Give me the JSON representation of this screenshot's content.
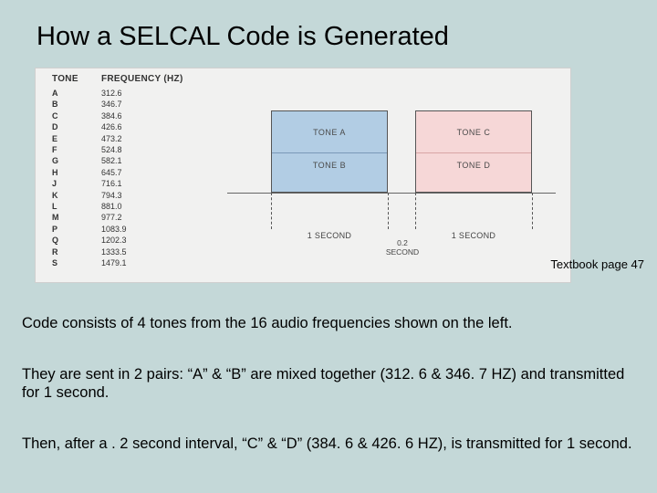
{
  "title": "How a SELCAL Code is Generated",
  "figure": {
    "table": {
      "headers": {
        "tone": "TONE",
        "freq": "FREQUENCY (HZ)"
      },
      "rows": [
        {
          "t": "A",
          "f": "312.6"
        },
        {
          "t": "B",
          "f": "346.7"
        },
        {
          "t": "C",
          "f": "384.6"
        },
        {
          "t": "D",
          "f": "426.6"
        },
        {
          "t": "E",
          "f": "473.2"
        },
        {
          "t": "F",
          "f": "524.8"
        },
        {
          "t": "G",
          "f": "582.1"
        },
        {
          "t": "H",
          "f": "645.7"
        },
        {
          "t": "J",
          "f": "716.1"
        },
        {
          "t": "K",
          "f": "794.3"
        },
        {
          "t": "L",
          "f": "881.0"
        },
        {
          "t": "M",
          "f": "977.2"
        },
        {
          "t": "P",
          "f": "1083.9"
        },
        {
          "t": "Q",
          "f": "1202.3"
        },
        {
          "t": "R",
          "f": "1333.5"
        },
        {
          "t": "S",
          "f": "1479.1"
        }
      ]
    },
    "labels": {
      "toneA": "TONE A",
      "toneB": "TONE B",
      "toneC": "TONE C",
      "toneD": "TONE D",
      "sec1": "1 SECOND",
      "sec2": "1 SECOND",
      "gap_top": "0.2",
      "gap_bot": "SECOND"
    }
  },
  "page_ref": "Textbook page 47",
  "paragraphs": {
    "p1": "Code consists of 4 tones from the 16 audio frequencies shown on the left.",
    "p2": "They are sent in 2 pairs: “A” & “B” are mixed together (312. 6 & 346. 7 HZ) and transmitted for 1 second.",
    "p3": "Then, after a . 2 second interval, “C” & “D” (384. 6 & 426. 6 HZ), is transmitted for 1 second."
  },
  "chart_data": {
    "type": "table",
    "title": "SELCAL tone frequency table and transmission timing",
    "tones": [
      {
        "tone": "A",
        "hz": 312.6
      },
      {
        "tone": "B",
        "hz": 346.7
      },
      {
        "tone": "C",
        "hz": 384.6
      },
      {
        "tone": "D",
        "hz": 426.6
      },
      {
        "tone": "E",
        "hz": 473.2
      },
      {
        "tone": "F",
        "hz": 524.8
      },
      {
        "tone": "G",
        "hz": 582.1
      },
      {
        "tone": "H",
        "hz": 645.7
      },
      {
        "tone": "J",
        "hz": 716.1
      },
      {
        "tone": "K",
        "hz": 794.3
      },
      {
        "tone": "L",
        "hz": 881.0
      },
      {
        "tone": "M",
        "hz": 977.2
      },
      {
        "tone": "P",
        "hz": 1083.9
      },
      {
        "tone": "Q",
        "hz": 1202.3
      },
      {
        "tone": "R",
        "hz": 1333.5
      },
      {
        "tone": "S",
        "hz": 1479.1
      }
    ],
    "timing": {
      "pair1": {
        "tones": [
          "A",
          "B"
        ],
        "duration_s": 1.0
      },
      "gap_s": 0.2,
      "pair2": {
        "tones": [
          "C",
          "D"
        ],
        "duration_s": 1.0
      }
    }
  }
}
